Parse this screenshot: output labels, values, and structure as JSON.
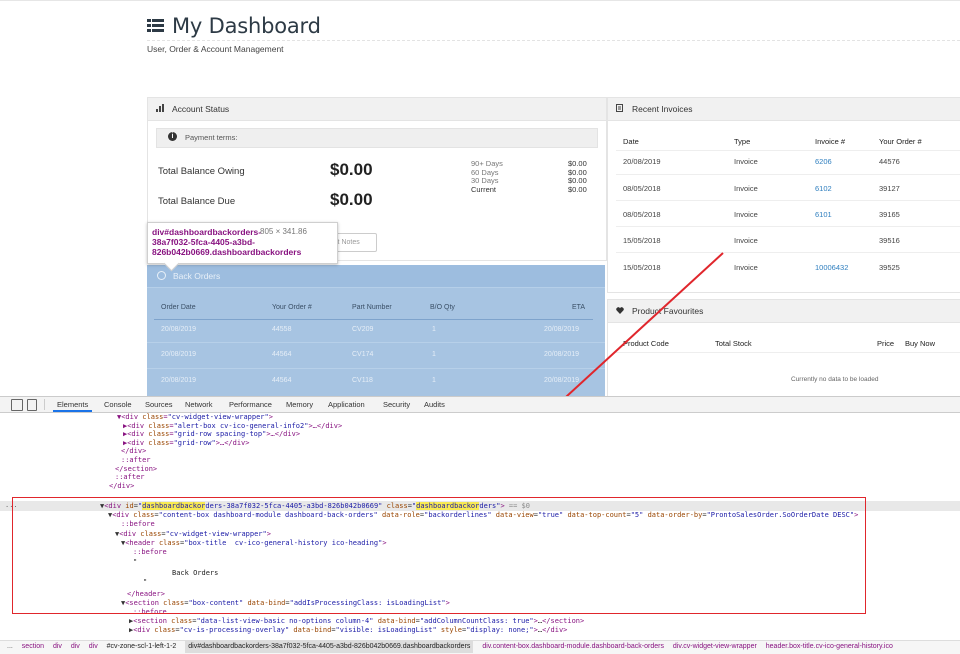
{
  "page": {
    "title": "My Dashboard",
    "subtitle": "User, Order & Account Management"
  },
  "account_status": {
    "header": "Account Status",
    "payment_terms": "Payment terms:",
    "total_owing_label": "Total Balance Owing",
    "total_owing_value": "$0.00",
    "total_due_label": "Total Balance Due",
    "total_due_value": "$0.00",
    "aging": [
      {
        "label": "90+ Days",
        "value": "$0.00"
      },
      {
        "label": "60 Days",
        "value": "$0.00"
      },
      {
        "label": "30 Days",
        "value": "$0.00"
      },
      {
        "label": "Current",
        "value": "$0.00"
      }
    ],
    "credit_notes_button": "it Notes"
  },
  "tooltip": {
    "selector": "div#dashboardbackorders-38a7f032-5fca-4405-a3bd-826b042b0669.dashboardbackorders",
    "dims": "805 × 341.86"
  },
  "back_orders": {
    "header": "Back Orders",
    "columns": [
      "Order Date",
      "Your Order #",
      "Part Number",
      "B/O Qty",
      "ETA"
    ],
    "rows": [
      [
        "20/08/2019",
        "44558",
        "CV209",
        "1",
        "20/08/2019"
      ],
      [
        "20/08/2019",
        "44564",
        "CV174",
        "1",
        "20/08/2019"
      ],
      [
        "20/08/2019",
        "44564",
        "CV118",
        "1",
        "20/08/2019"
      ]
    ]
  },
  "recent_invoices": {
    "header": "Recent Invoices",
    "columns": [
      "Date",
      "Type",
      "Invoice #",
      "Your Order #"
    ],
    "rows": [
      [
        "20/08/2019",
        "Invoice",
        "6206",
        "44576"
      ],
      [
        "08/05/2018",
        "Invoice",
        "6102",
        "39127"
      ],
      [
        "08/05/2018",
        "Invoice",
        "6101",
        "39165"
      ],
      [
        "15/05/2018",
        "Invoice",
        "",
        "39516"
      ],
      [
        "15/05/2018",
        "Invoice",
        "10006432",
        "39525"
      ]
    ]
  },
  "product_favourites": {
    "header": "Product Favourites",
    "columns": [
      "Product Code",
      "Total Stock",
      "Price",
      "Buy Now"
    ],
    "empty_text": "Currently no data to be loaded"
  },
  "devtools": {
    "tabs": [
      "Elements",
      "Console",
      "Sources",
      "Network",
      "Performance",
      "Memory",
      "Application",
      "Security",
      "Audits"
    ],
    "active_tab": "Elements",
    "breadcrumbs": [
      "...",
      "section",
      "div",
      "div",
      "div",
      "#cv-zone-scl-1-left-1-2",
      "div#dashboardbackorders-38a7f032-5fca-4405-a3bd-826b042b0669.dashboardbackorders",
      "div.content-box.dashboard-module.dashboard-back-orders",
      "div.cv-widget-view-wrapper",
      "header.box-title.cv-ico-general-history.ico"
    ]
  },
  "colors": {
    "highlight": "#a7c4e2",
    "annotation_red": "#e0262c",
    "link_blue": "#2f7fbf",
    "devtools_tag": "#881280"
  }
}
